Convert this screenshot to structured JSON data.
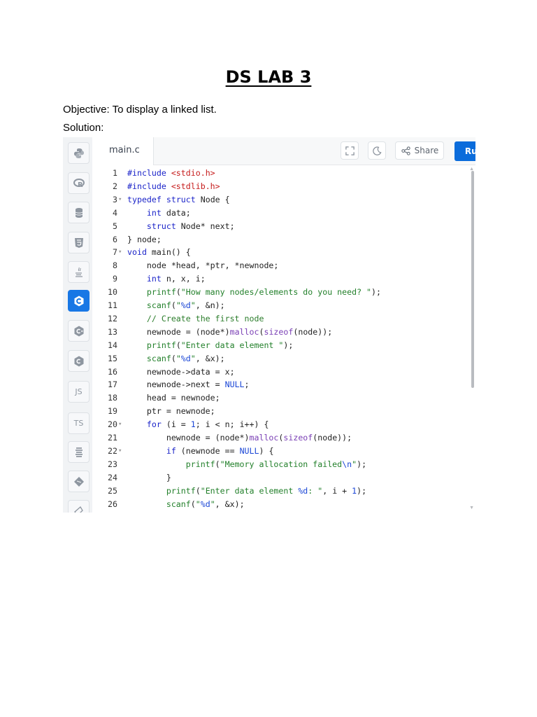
{
  "doc": {
    "title": "DS LAB 3",
    "objective": "Objective: To display a linked list.",
    "solution": "Solution:"
  },
  "editor": {
    "tab": "main.c",
    "share_label": "Share",
    "run_label": "Run",
    "icons": {
      "fullscreen": "fullscreen-icon",
      "theme": "moon-icon",
      "share": "share-icon"
    },
    "languages": [
      {
        "name": "python-icon"
      },
      {
        "name": "r-icon"
      },
      {
        "name": "sql-icon"
      },
      {
        "name": "html-icon"
      },
      {
        "name": "java-icon"
      },
      {
        "name": "c-icon",
        "active": true
      },
      {
        "name": "cpp-icon"
      },
      {
        "name": "csharp-icon"
      },
      {
        "name": "js-icon",
        "label": "JS"
      },
      {
        "name": "ts-icon",
        "label": "TS"
      },
      {
        "name": "go-icon"
      },
      {
        "name": "php-icon"
      },
      {
        "name": "swift-icon"
      }
    ],
    "colors": {
      "accent": "#0b6cdb",
      "keyword": "#1b24c9",
      "string": "#23802b",
      "include": "#c51b1b"
    },
    "lines": [
      {
        "n": "1",
        "fold": false,
        "text": "#include <stdio.h>"
      },
      {
        "n": "2",
        "fold": false,
        "text": "#include <stdlib.h>"
      },
      {
        "n": "3",
        "fold": true,
        "text": "typedef struct Node {"
      },
      {
        "n": "4",
        "fold": false,
        "text": "    int data;"
      },
      {
        "n": "5",
        "fold": false,
        "text": "    struct Node* next;"
      },
      {
        "n": "6",
        "fold": false,
        "text": "} node;"
      },
      {
        "n": "7",
        "fold": true,
        "text": "void main() {"
      },
      {
        "n": "8",
        "fold": false,
        "text": "    node *head, *ptr, *newnode;"
      },
      {
        "n": "9",
        "fold": false,
        "text": "    int n, x, i;"
      },
      {
        "n": "10",
        "fold": false,
        "text": "    printf(\"How many nodes/elements do you need? \");"
      },
      {
        "n": "11",
        "fold": false,
        "text": "    scanf(\"%d\", &n);"
      },
      {
        "n": "12",
        "fold": false,
        "text": "    // Create the first node"
      },
      {
        "n": "13",
        "fold": false,
        "text": "    newnode = (node*)malloc(sizeof(node));"
      },
      {
        "n": "14",
        "fold": false,
        "text": "    printf(\"Enter data element \");"
      },
      {
        "n": "15",
        "fold": false,
        "text": "    scanf(\"%d\", &x);"
      },
      {
        "n": "16",
        "fold": false,
        "text": "    newnode->data = x;"
      },
      {
        "n": "17",
        "fold": false,
        "text": "    newnode->next = NULL;"
      },
      {
        "n": "18",
        "fold": false,
        "text": "    head = newnode;"
      },
      {
        "n": "19",
        "fold": false,
        "text": "    ptr = newnode;"
      },
      {
        "n": "20",
        "fold": true,
        "text": "    for (i = 1; i < n; i++) {"
      },
      {
        "n": "21",
        "fold": false,
        "text": "        newnode = (node*)malloc(sizeof(node));"
      },
      {
        "n": "22",
        "fold": true,
        "text": "        if (newnode == NULL) {"
      },
      {
        "n": "23",
        "fold": false,
        "text": "            printf(\"Memory allocation failed\\n\");"
      },
      {
        "n": "24",
        "fold": false,
        "text": "        }"
      },
      {
        "n": "25",
        "fold": false,
        "text": "        printf(\"Enter data element %d: \", i + 1);"
      },
      {
        "n": "26",
        "fold": false,
        "text": "        scanf(\"%d\", &x);"
      }
    ]
  }
}
